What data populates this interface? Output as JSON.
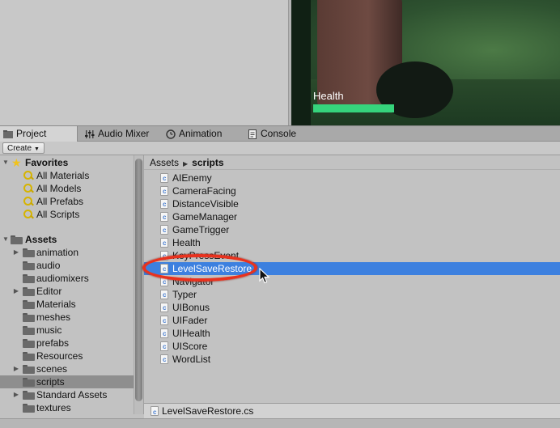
{
  "game_view": {
    "health_label": "Health",
    "health_fraction": 1.0,
    "health_color": "#36d47c"
  },
  "tabs": [
    {
      "label": "Project",
      "icon": "project-icon",
      "active": true
    },
    {
      "label": "Audio Mixer",
      "icon": "audio-mixer-icon",
      "active": false
    },
    {
      "label": "Animation",
      "icon": "animation-clock-icon",
      "active": false
    },
    {
      "label": "Console",
      "icon": "console-icon",
      "active": false
    }
  ],
  "toolbar": {
    "create_label": "Create"
  },
  "tree": {
    "favorites": {
      "label": "Favorites",
      "items": [
        "All Materials",
        "All Models",
        "All Prefabs",
        "All Scripts"
      ]
    },
    "assets": {
      "label": "Assets",
      "items": [
        {
          "label": "animation",
          "expandable": true
        },
        {
          "label": "audio",
          "expandable": false
        },
        {
          "label": "audiomixers",
          "expandable": false
        },
        {
          "label": "Editor",
          "expandable": true
        },
        {
          "label": "Materials",
          "expandable": false
        },
        {
          "label": "meshes",
          "expandable": false
        },
        {
          "label": "music",
          "expandable": false
        },
        {
          "label": "prefabs",
          "expandable": false
        },
        {
          "label": "Resources",
          "expandable": false
        },
        {
          "label": "scenes",
          "expandable": true
        },
        {
          "label": "scripts",
          "expandable": false,
          "selected": true
        },
        {
          "label": "Standard Assets",
          "expandable": true
        },
        {
          "label": "textures",
          "expandable": false
        }
      ]
    }
  },
  "breadcrumb": {
    "root": "Assets",
    "current": "scripts"
  },
  "files": [
    "AIEnemy",
    "CameraFacing",
    "DistanceVisible",
    "GameManager",
    "GameTrigger",
    "Health",
    "KeyPressEvent",
    "LevelSaveRestore",
    "Navigator",
    "Typer",
    "UIBonus",
    "UIFader",
    "UIHealth",
    "UIScore",
    "WordList"
  ],
  "selected_file": "LevelSaveRestore",
  "status": {
    "selected_path": "LevelSaveRestore.cs"
  },
  "colors": {
    "selection": "#3d80df",
    "annotation": "#e8321e",
    "favorite_star": "#f1c21b"
  }
}
